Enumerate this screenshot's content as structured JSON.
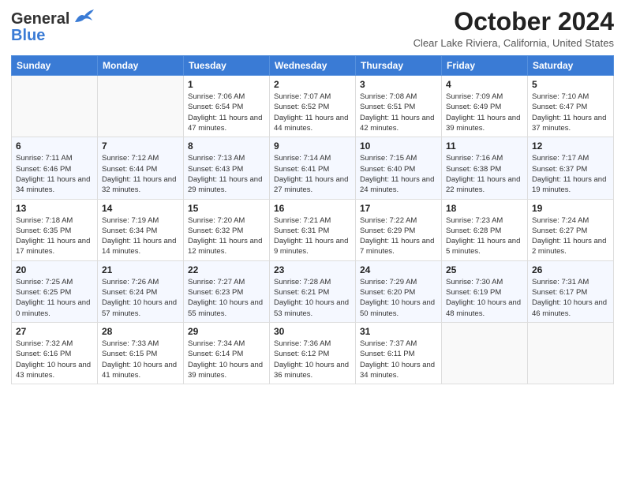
{
  "header": {
    "logo_line1": "General",
    "logo_line2": "Blue",
    "month_title": "October 2024",
    "location": "Clear Lake Riviera, California, United States"
  },
  "days_of_week": [
    "Sunday",
    "Monday",
    "Tuesday",
    "Wednesday",
    "Thursday",
    "Friday",
    "Saturday"
  ],
  "weeks": [
    [
      {
        "day": "",
        "info": ""
      },
      {
        "day": "",
        "info": ""
      },
      {
        "day": "1",
        "info": "Sunrise: 7:06 AM\nSunset: 6:54 PM\nDaylight: 11 hours and 47 minutes."
      },
      {
        "day": "2",
        "info": "Sunrise: 7:07 AM\nSunset: 6:52 PM\nDaylight: 11 hours and 44 minutes."
      },
      {
        "day": "3",
        "info": "Sunrise: 7:08 AM\nSunset: 6:51 PM\nDaylight: 11 hours and 42 minutes."
      },
      {
        "day": "4",
        "info": "Sunrise: 7:09 AM\nSunset: 6:49 PM\nDaylight: 11 hours and 39 minutes."
      },
      {
        "day": "5",
        "info": "Sunrise: 7:10 AM\nSunset: 6:47 PM\nDaylight: 11 hours and 37 minutes."
      }
    ],
    [
      {
        "day": "6",
        "info": "Sunrise: 7:11 AM\nSunset: 6:46 PM\nDaylight: 11 hours and 34 minutes."
      },
      {
        "day": "7",
        "info": "Sunrise: 7:12 AM\nSunset: 6:44 PM\nDaylight: 11 hours and 32 minutes."
      },
      {
        "day": "8",
        "info": "Sunrise: 7:13 AM\nSunset: 6:43 PM\nDaylight: 11 hours and 29 minutes."
      },
      {
        "day": "9",
        "info": "Sunrise: 7:14 AM\nSunset: 6:41 PM\nDaylight: 11 hours and 27 minutes."
      },
      {
        "day": "10",
        "info": "Sunrise: 7:15 AM\nSunset: 6:40 PM\nDaylight: 11 hours and 24 minutes."
      },
      {
        "day": "11",
        "info": "Sunrise: 7:16 AM\nSunset: 6:38 PM\nDaylight: 11 hours and 22 minutes."
      },
      {
        "day": "12",
        "info": "Sunrise: 7:17 AM\nSunset: 6:37 PM\nDaylight: 11 hours and 19 minutes."
      }
    ],
    [
      {
        "day": "13",
        "info": "Sunrise: 7:18 AM\nSunset: 6:35 PM\nDaylight: 11 hours and 17 minutes."
      },
      {
        "day": "14",
        "info": "Sunrise: 7:19 AM\nSunset: 6:34 PM\nDaylight: 11 hours and 14 minutes."
      },
      {
        "day": "15",
        "info": "Sunrise: 7:20 AM\nSunset: 6:32 PM\nDaylight: 11 hours and 12 minutes."
      },
      {
        "day": "16",
        "info": "Sunrise: 7:21 AM\nSunset: 6:31 PM\nDaylight: 11 hours and 9 minutes."
      },
      {
        "day": "17",
        "info": "Sunrise: 7:22 AM\nSunset: 6:29 PM\nDaylight: 11 hours and 7 minutes."
      },
      {
        "day": "18",
        "info": "Sunrise: 7:23 AM\nSunset: 6:28 PM\nDaylight: 11 hours and 5 minutes."
      },
      {
        "day": "19",
        "info": "Sunrise: 7:24 AM\nSunset: 6:27 PM\nDaylight: 11 hours and 2 minutes."
      }
    ],
    [
      {
        "day": "20",
        "info": "Sunrise: 7:25 AM\nSunset: 6:25 PM\nDaylight: 11 hours and 0 minutes."
      },
      {
        "day": "21",
        "info": "Sunrise: 7:26 AM\nSunset: 6:24 PM\nDaylight: 10 hours and 57 minutes."
      },
      {
        "day": "22",
        "info": "Sunrise: 7:27 AM\nSunset: 6:23 PM\nDaylight: 10 hours and 55 minutes."
      },
      {
        "day": "23",
        "info": "Sunrise: 7:28 AM\nSunset: 6:21 PM\nDaylight: 10 hours and 53 minutes."
      },
      {
        "day": "24",
        "info": "Sunrise: 7:29 AM\nSunset: 6:20 PM\nDaylight: 10 hours and 50 minutes."
      },
      {
        "day": "25",
        "info": "Sunrise: 7:30 AM\nSunset: 6:19 PM\nDaylight: 10 hours and 48 minutes."
      },
      {
        "day": "26",
        "info": "Sunrise: 7:31 AM\nSunset: 6:17 PM\nDaylight: 10 hours and 46 minutes."
      }
    ],
    [
      {
        "day": "27",
        "info": "Sunrise: 7:32 AM\nSunset: 6:16 PM\nDaylight: 10 hours and 43 minutes."
      },
      {
        "day": "28",
        "info": "Sunrise: 7:33 AM\nSunset: 6:15 PM\nDaylight: 10 hours and 41 minutes."
      },
      {
        "day": "29",
        "info": "Sunrise: 7:34 AM\nSunset: 6:14 PM\nDaylight: 10 hours and 39 minutes."
      },
      {
        "day": "30",
        "info": "Sunrise: 7:36 AM\nSunset: 6:12 PM\nDaylight: 10 hours and 36 minutes."
      },
      {
        "day": "31",
        "info": "Sunrise: 7:37 AM\nSunset: 6:11 PM\nDaylight: 10 hours and 34 minutes."
      },
      {
        "day": "",
        "info": ""
      },
      {
        "day": "",
        "info": ""
      }
    ]
  ]
}
